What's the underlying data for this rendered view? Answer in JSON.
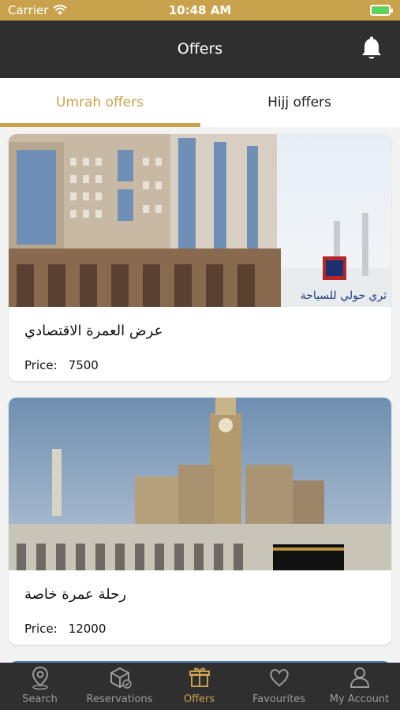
{
  "status_bar": {
    "carrier": "Carrier",
    "time": "10:48 AM"
  },
  "header": {
    "title": "Offers"
  },
  "tabs": [
    {
      "label": "Umrah offers",
      "active": true
    },
    {
      "label": "Hijj offers",
      "active": false
    }
  ],
  "offers": [
    {
      "name": "عرض العمرة الاقتصادي",
      "price_label": "Price:",
      "price": "7500",
      "watermark": "ثري حولي للسياحة"
    },
    {
      "name": "رحلة عمرة خاصة",
      "price_label": "Price:",
      "price": "12000"
    }
  ],
  "bottom_nav": [
    {
      "label": "Search",
      "icon": "map-pin-icon"
    },
    {
      "label": "Reservations",
      "icon": "box-icon"
    },
    {
      "label": "Offers",
      "icon": "gift-icon",
      "active": true
    },
    {
      "label": "Favourites",
      "icon": "heart-icon"
    },
    {
      "label": "My Account",
      "icon": "person-icon"
    }
  ],
  "colors": {
    "accent": "#c9a24d",
    "bar": "#2f2f2f",
    "background": "#f3f3f3"
  }
}
